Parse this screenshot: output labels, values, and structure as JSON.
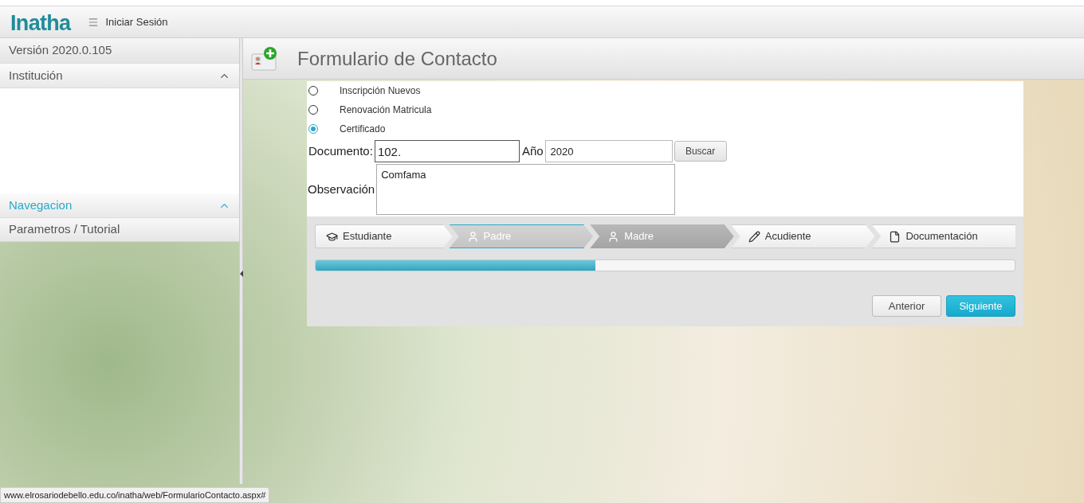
{
  "header": {
    "logo": "Inatha",
    "menu_label": "Iniciar Sesión"
  },
  "sidebar": {
    "version": "Versión 2020.0.105",
    "sections": [
      {
        "title": "Institución",
        "expanded": true,
        "selected": false
      },
      {
        "title": "Navegacion",
        "expanded": true,
        "selected": true,
        "items": [
          "Parametros / Tutorial"
        ]
      }
    ]
  },
  "page": {
    "title": "Formulario de Contacto"
  },
  "form": {
    "options": [
      {
        "label": "Inscripción Nuevos",
        "selected": false
      },
      {
        "label": "Renovación Matricula",
        "selected": false
      },
      {
        "label": "Certificado",
        "selected": true
      }
    ],
    "documento_label": "Documento:",
    "documento_value": "102.",
    "anio_label": "Año",
    "anio_value": "2020",
    "search_button": "Buscar",
    "observacion_label": "Observación",
    "observacion_value": "Comfama"
  },
  "wizard": {
    "steps": [
      {
        "label": "Estudiante",
        "kind": "student",
        "selected": false,
        "highlighted": false
      },
      {
        "label": "Padre",
        "kind": "person",
        "selected": true,
        "highlighted": false
      },
      {
        "label": "Madre",
        "kind": "person",
        "selected": false,
        "highlighted": true
      },
      {
        "label": "Acudiente",
        "kind": "pencil",
        "selected": false,
        "highlighted": false
      },
      {
        "label": "Documentación",
        "kind": "document",
        "selected": false,
        "highlighted": false
      }
    ],
    "progress": {
      "level": 0.4
    },
    "buttons": [
      {
        "label": "Anterior",
        "kind": "secondary"
      },
      {
        "label": "Siguiente",
        "kind": "primary"
      }
    ]
  },
  "status_bar": "www.elrosariodebello.edu.co/inatha/web/FormularioContacto.aspx#"
}
